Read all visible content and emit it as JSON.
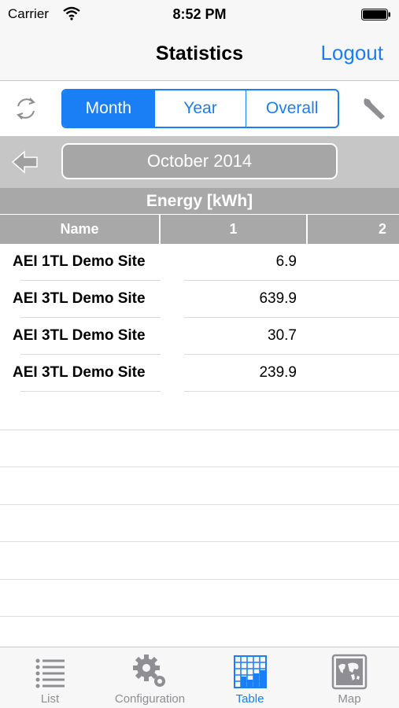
{
  "status_bar": {
    "carrier": "Carrier",
    "time": "8:52 PM"
  },
  "nav": {
    "title": "Statistics",
    "logout_label": "Logout"
  },
  "segments": [
    {
      "label": "Month",
      "active": true
    },
    {
      "label": "Year",
      "active": false
    },
    {
      "label": "Overall",
      "active": false
    }
  ],
  "period": {
    "label": "October 2014"
  },
  "table": {
    "title": "Energy [kWh]",
    "columns": [
      "Name",
      "1",
      "2"
    ],
    "rows": [
      {
        "name": "AEI 1TL Demo Site",
        "value": "6.9"
      },
      {
        "name": "AEI 3TL Demo Site",
        "value": "639.9"
      },
      {
        "name": "AEI 3TL Demo Site",
        "value": "30.7"
      },
      {
        "name": "AEI 3TL Demo Site",
        "value": "239.9"
      }
    ]
  },
  "tabs": [
    {
      "label": "List",
      "icon": "list-icon",
      "active": false
    },
    {
      "label": "Configuration",
      "icon": "gears-icon",
      "active": false
    },
    {
      "label": "Table",
      "icon": "table-chart-icon",
      "active": true
    },
    {
      "label": "Map",
      "icon": "map-icon",
      "active": false
    }
  ],
  "colors": {
    "accent": "#1a7ef5",
    "header_gray": "#a8a8a8",
    "period_bar": "#c6c6c6"
  }
}
